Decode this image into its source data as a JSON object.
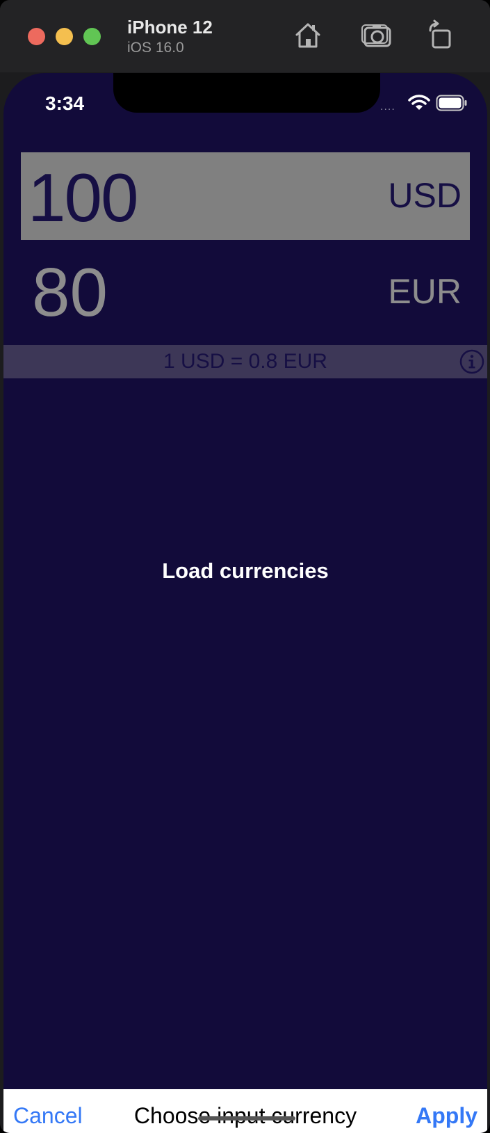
{
  "simulator": {
    "device_name": "iPhone 12",
    "os_version": "iOS 16.0",
    "toolbar": {
      "home_icon": "home-icon",
      "screenshot_icon": "camera-icon",
      "rotate_icon": "rotate-icon"
    }
  },
  "status_bar": {
    "time": "3:34",
    "signal": "....",
    "wifi_icon": "wifi-icon",
    "battery_icon": "battery-icon"
  },
  "converter": {
    "input": {
      "amount": "100",
      "currency": "USD"
    },
    "output": {
      "amount": "80",
      "currency": "EUR"
    },
    "rate_text": "1 USD = 0.8 EUR",
    "info_icon": "info-icon"
  },
  "loading": {
    "label": "Load currencies"
  },
  "picker_toolbar": {
    "cancel_label": "Cancel",
    "title": "Choose input currency",
    "apply_label": "Apply"
  },
  "colors": {
    "background": "#120b3a",
    "input_highlight": "#808080",
    "rate_bar": "#3d3757",
    "link_blue": "#3478f6"
  }
}
